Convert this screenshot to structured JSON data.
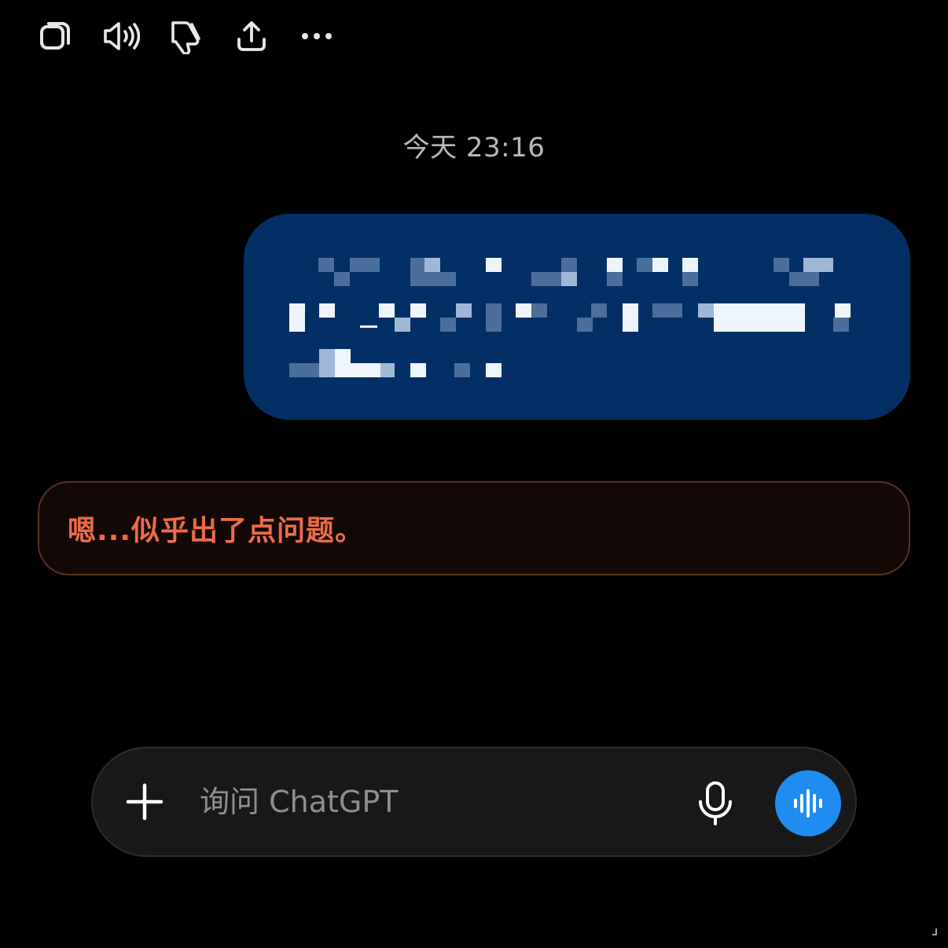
{
  "toolbar": {
    "buttons": [
      {
        "name": "copy-button",
        "icon": "copy-icon"
      },
      {
        "name": "read-aloud-button",
        "icon": "speaker-icon"
      },
      {
        "name": "thumbs-down-button",
        "icon": "thumbs-down-icon"
      },
      {
        "name": "share-button",
        "icon": "share-icon"
      },
      {
        "name": "more-button",
        "icon": "more-horizontal-icon"
      }
    ]
  },
  "conversation": {
    "timestamp": "今天 23:16",
    "user_message": {
      "redacted": true,
      "bubble_color": "#023064"
    },
    "error_message": {
      "text": "嗯...似乎出了点问题。",
      "text_color": "#ec6c49",
      "border_color": "#5a3225"
    }
  },
  "composer": {
    "placeholder": "询问 ChatGPT",
    "value": "",
    "plus_icon": "plus-icon",
    "mic_icon": "microphone-icon",
    "voice_icon": "voice-waveform-icon",
    "voice_button_color": "#1f8cf0"
  }
}
